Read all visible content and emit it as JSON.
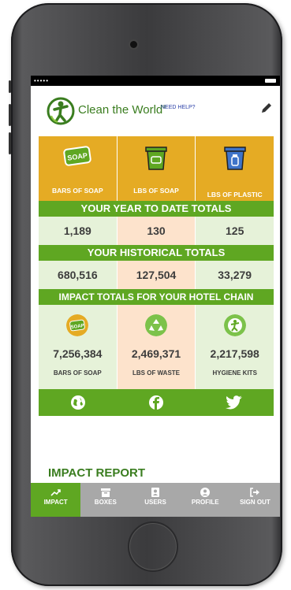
{
  "app": {
    "brand": "Clean the World",
    "trademark": "®",
    "help_label": "NEED HELP?"
  },
  "status_bar": {
    "signal": "•••••"
  },
  "categories": [
    {
      "label": "BARS OF SOAP",
      "icon": "soap-icon",
      "badge": "SOAP"
    },
    {
      "label": "LBS OF SOAP",
      "icon": "green-bin-icon"
    },
    {
      "label": "LBS OF PLASTIC",
      "icon": "blue-bin-icon"
    }
  ],
  "ytd": {
    "title": "YOUR YEAR TO DATE TOTALS",
    "values": [
      "1,189",
      "130",
      "125"
    ]
  },
  "historical": {
    "title": "YOUR HISTORICAL TOTALS",
    "values": [
      "680,516",
      "127,504",
      "33,279"
    ]
  },
  "chain": {
    "title": "IMPACT TOTALS FOR YOUR HOTEL CHAIN",
    "items": [
      {
        "value": "7,256,384",
        "label": "BARS OF SOAP",
        "icon": "soap-badge-icon",
        "badge": "SOAP"
      },
      {
        "value": "2,469,371",
        "label": "LBS OF WASTE",
        "icon": "recycle-icon"
      },
      {
        "value": "2,217,598",
        "label": "HYGIENE KITS",
        "icon": "hygiene-kit-icon"
      }
    ]
  },
  "social": [
    "globe-icon",
    "facebook-icon",
    "twitter-icon"
  ],
  "report_title": "IMPACT REPORT",
  "tabs": [
    {
      "label": "IMPACT",
      "icon": "trending-icon",
      "active": true
    },
    {
      "label": "BOXES",
      "icon": "box-icon"
    },
    {
      "label": "USERS",
      "icon": "user-card-icon"
    },
    {
      "label": "PROFILE",
      "icon": "profile-icon"
    },
    {
      "label": "SIGN OUT",
      "icon": "sign-out-icon"
    }
  ],
  "colors": {
    "green": "#5fa722",
    "gold": "#e5ab24",
    "light_green": "#e6f2d9",
    "peach": "#fde3cc",
    "brand_green": "#3a7d1f"
  }
}
